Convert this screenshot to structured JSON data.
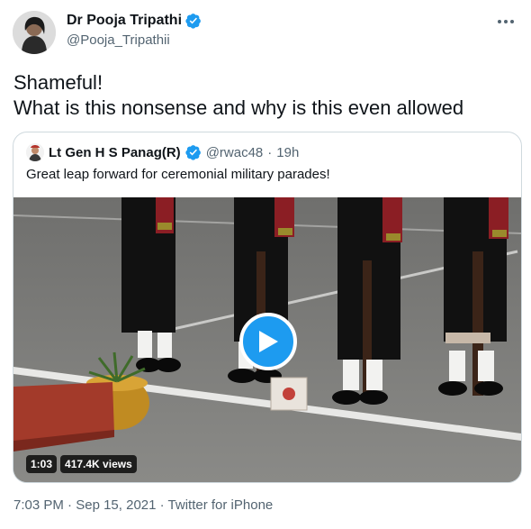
{
  "tweet": {
    "author": {
      "name": "Dr Pooja Tripathi",
      "handle": "@Pooja_Tripathii",
      "verified": true
    },
    "text": "Shameful!\nWhat is this nonsense and why is this even allowed",
    "timestamp": "7:03 PM",
    "separator": "·",
    "date": "Sep 15, 2021",
    "source": "Twitter for iPhone"
  },
  "quoted_tweet": {
    "author": {
      "name": "Lt Gen H S Panag(R)",
      "handle": "@rwac48",
      "verified": true
    },
    "separator": "·",
    "time": "19h",
    "text": "Great leap forward for ceremonial military parades!",
    "video": {
      "duration": "1:03",
      "views": "417.4K views"
    }
  },
  "colors": {
    "accent": "#1d9bf0",
    "text_primary": "#0f1419",
    "text_secondary": "#536471",
    "border": "#cfd9de"
  },
  "icons": {
    "verified": "verified-badge-icon",
    "more": "more-horizontal-icon",
    "play": "play-icon"
  }
}
